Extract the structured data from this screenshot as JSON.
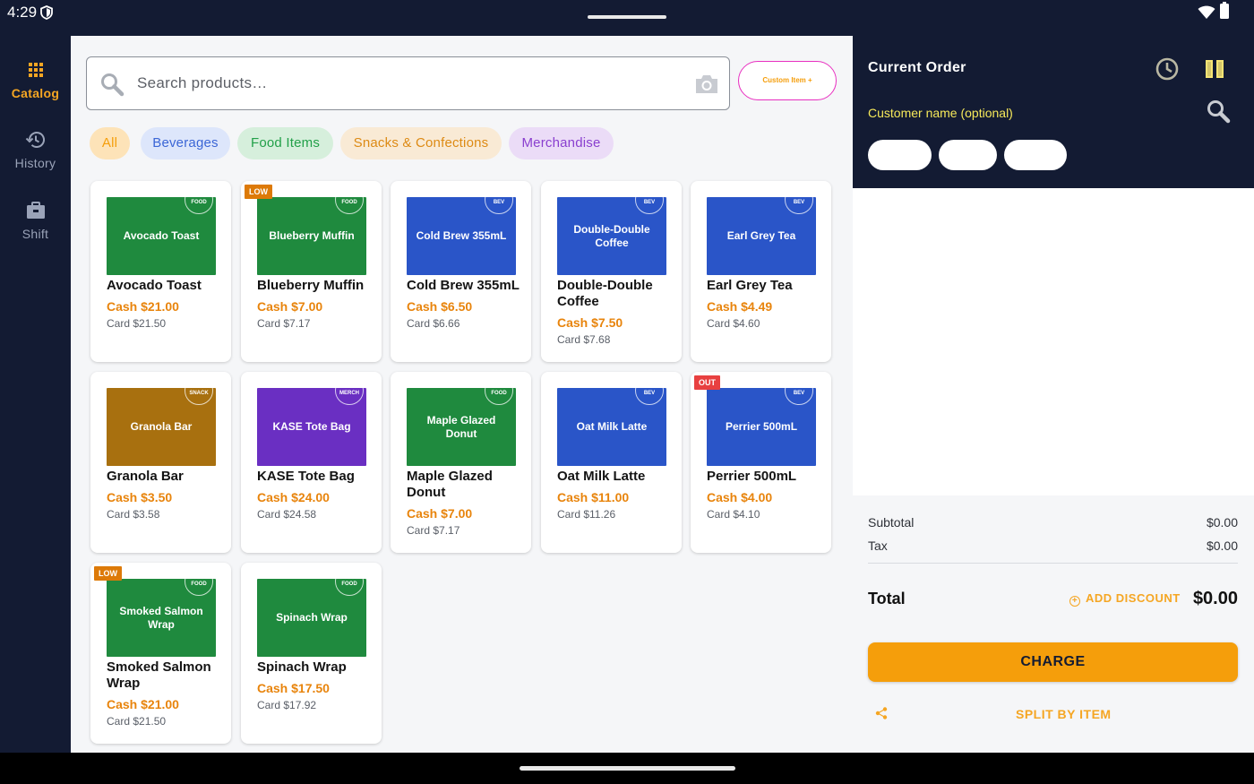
{
  "status": {
    "time": "4:29"
  },
  "nav": {
    "catalog": "Catalog",
    "history": "History",
    "shift": "Shift"
  },
  "search": {
    "placeholder": "Search products…"
  },
  "custom_item_label": "Custom Item +",
  "categories": [
    {
      "label": "All",
      "bg": "#fde3b8",
      "color": "#f59e0b"
    },
    {
      "label": "Beverages",
      "bg": "#dde6fb",
      "color": "#3b66d6"
    },
    {
      "label": "Food Items",
      "bg": "#d6efdc",
      "color": "#22a049"
    },
    {
      "label": "Snacks & Confections",
      "bg": "#f9ead5",
      "color": "#dd8a14"
    },
    {
      "label": "Merchandise",
      "bg": "#ebdcf7",
      "color": "#8a3fcf"
    }
  ],
  "products": [
    {
      "name": "Avocado Toast",
      "tile": "Avocado Toast",
      "cat": "FOOD",
      "cash": "Cash $21.00",
      "card": "Card $21.50",
      "badge": "",
      "color": "green"
    },
    {
      "name": "Blueberry Muffin",
      "tile": "Blueberry Muffin",
      "cat": "FOOD",
      "cash": "Cash $7.00",
      "card": "Card $7.17",
      "badge": "LOW",
      "color": "green"
    },
    {
      "name": "Cold Brew 355mL",
      "tile": "Cold Brew 355mL",
      "cat": "BEV",
      "cash": "Cash $6.50",
      "card": "Card $6.66",
      "badge": "",
      "color": "blue"
    },
    {
      "name": "Double-Double Coffee",
      "tile": "Double-Double Coffee",
      "cat": "BEV",
      "cash": "Cash $7.50",
      "card": "Card $7.68",
      "badge": "",
      "color": "blue"
    },
    {
      "name": "Earl Grey Tea",
      "tile": "Earl Grey Tea",
      "cat": "BEV",
      "cash": "Cash $4.49",
      "card": "Card $4.60",
      "badge": "",
      "color": "blue"
    },
    {
      "name": "Granola Bar",
      "tile": "Granola Bar",
      "cat": "SNACK",
      "cash": "Cash $3.50",
      "card": "Card $3.58",
      "badge": "",
      "color": "gold"
    },
    {
      "name": "KASE Tote Bag",
      "tile": "KASE Tote Bag",
      "cat": "MERCH",
      "cash": "Cash $24.00",
      "card": "Card $24.58",
      "badge": "",
      "color": "purple"
    },
    {
      "name": "Maple Glazed Donut",
      "tile": "Maple Glazed Donut",
      "cat": "FOOD",
      "cash": "Cash $7.00",
      "card": "Card $7.17",
      "badge": "",
      "color": "green"
    },
    {
      "name": "Oat Milk Latte",
      "tile": "Oat Milk Latte",
      "cat": "BEV",
      "cash": "Cash $11.00",
      "card": "Card $11.26",
      "badge": "",
      "color": "blue"
    },
    {
      "name": "Perrier 500mL",
      "tile": "Perrier 500mL",
      "cat": "BEV",
      "cash": "Cash $4.00",
      "card": "Card $4.10",
      "badge": "OUT",
      "color": "blue"
    },
    {
      "name": "Smoked Salmon Wrap",
      "tile": "Smoked Salmon Wrap",
      "cat": "FOOD",
      "cash": "Cash $21.00",
      "card": "Card $21.50",
      "badge": "LOW",
      "color": "green"
    },
    {
      "name": "Spinach Wrap",
      "tile": "Spinach Wrap",
      "cat": "FOOD",
      "cash": "Cash $17.50",
      "card": "Card $17.92",
      "badge": "",
      "color": "green"
    }
  ],
  "tile_colors": {
    "green": "#1f8a3e",
    "blue": "#2a55c8",
    "gold": "#a8700f",
    "purple": "#6a2fc2"
  },
  "order": {
    "title": "Current Order",
    "customer_placeholder": "Customer name (optional)",
    "subtotal_label": "Subtotal",
    "subtotal_value": "$0.00",
    "tax_label": "Tax",
    "tax_value": "$0.00",
    "total_label": "Total",
    "add_discount": "ADD DISCOUNT",
    "total_value": "$0.00",
    "charge": "CHARGE",
    "split": "SPLIT BY ITEM"
  },
  "colors": {
    "accent": "#f59e0b",
    "dark": "#131b33"
  }
}
